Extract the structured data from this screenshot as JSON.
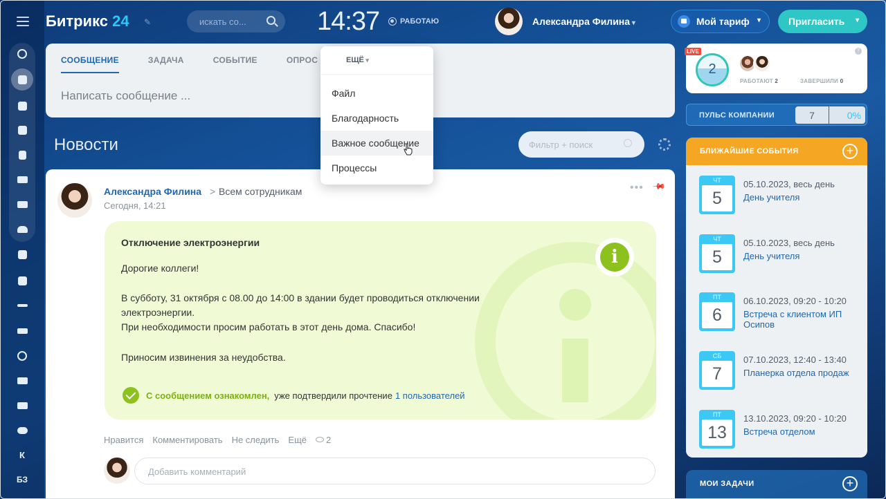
{
  "header": {
    "logo_main": "Битрикс",
    "logo_num": "24",
    "search_placeholder": "искать со...",
    "time": "14:37",
    "work_status": "РАБОТАЮ",
    "user_name": "Александра Филина",
    "tariff_label": "Мой тариф",
    "invite_label": "Пригласить"
  },
  "sidebar": {
    "items": [
      "К",
      "БЗ"
    ]
  },
  "composer": {
    "tabs": [
      "СООБЩЕНИЕ",
      "ЗАДАЧА",
      "СОБЫТИЕ",
      "ОПРОС"
    ],
    "placeholder": "Написать сообщение ..."
  },
  "more_menu": {
    "label": "ЕЩЁ",
    "items": [
      "Файл",
      "Благодарность",
      "Важное сообщение",
      "Процессы"
    ],
    "hovered": "Важное сообщение"
  },
  "feed": {
    "title": "Новости",
    "filter_placeholder": "Фильтр + поиск"
  },
  "post": {
    "author": "Александра Филина",
    "arrow": ">",
    "recipients": "Всем сотрудникам",
    "date": "Сегодня, 14:21",
    "important": {
      "title": "Отключение электроэнергии",
      "greeting": "Дорогие коллеги!",
      "body_1": "В субботу, 31 октября с 08.00 до 14:00 в здании будет проводиться отключении электроэнергии.",
      "body_2": "При необходимости просим работать в этот день дома. Спасибо!",
      "body_3": "Приносим извинения за неудобства.",
      "ack_label": "С сообщением ознакомлен,",
      "ack_text": "уже подтвердили прочтение",
      "ack_link": "1 пользователей"
    },
    "actions": {
      "like": "Нравится",
      "comment": "Комментировать",
      "unfollow": "Не следить",
      "more": "Ещё",
      "views": "2"
    },
    "comment_placeholder": "Добавить комментарий"
  },
  "right": {
    "live_badge": "LIVE",
    "online_count": "2",
    "working_label": "РАБОТАЮТ",
    "working_count": "2",
    "finished_label": "ЗАВЕРШИЛИ",
    "finished_count": "0",
    "pulse_label": "ПУЛЬС КОМПАНИИ",
    "pulse_value": "7",
    "pulse_percent": "0%",
    "events_title": "БЛИЖАЙШИЕ СОБЫТИЯ",
    "events": [
      {
        "weekday": "ЧТ",
        "day": "5",
        "when": "05.10.2023, весь день",
        "name": "День учителя"
      },
      {
        "weekday": "ЧТ",
        "day": "5",
        "when": "05.10.2023, весь день",
        "name": "День учителя"
      },
      {
        "weekday": "ПТ",
        "day": "6",
        "when": "06.10.2023, 09:20 - 10:20",
        "name": "Встреча с клиентом ИП Осипов"
      },
      {
        "weekday": "СБ",
        "day": "7",
        "when": "07.10.2023, 12:40 - 13:40",
        "name": "Планерка отдела продаж"
      },
      {
        "weekday": "ПТ",
        "day": "13",
        "when": "13.10.2023, 09:20 - 10:20",
        "name": "Встреча отделом"
      }
    ],
    "tasks_title": "МОИ ЗАДАЧИ"
  },
  "colors": {
    "accent_blue": "#2067b0",
    "important_bg": "#f0fbd6",
    "ack_green": "#8cc11e",
    "events_header": "#f5a623",
    "calendar_blue": "#3bc8f5"
  }
}
